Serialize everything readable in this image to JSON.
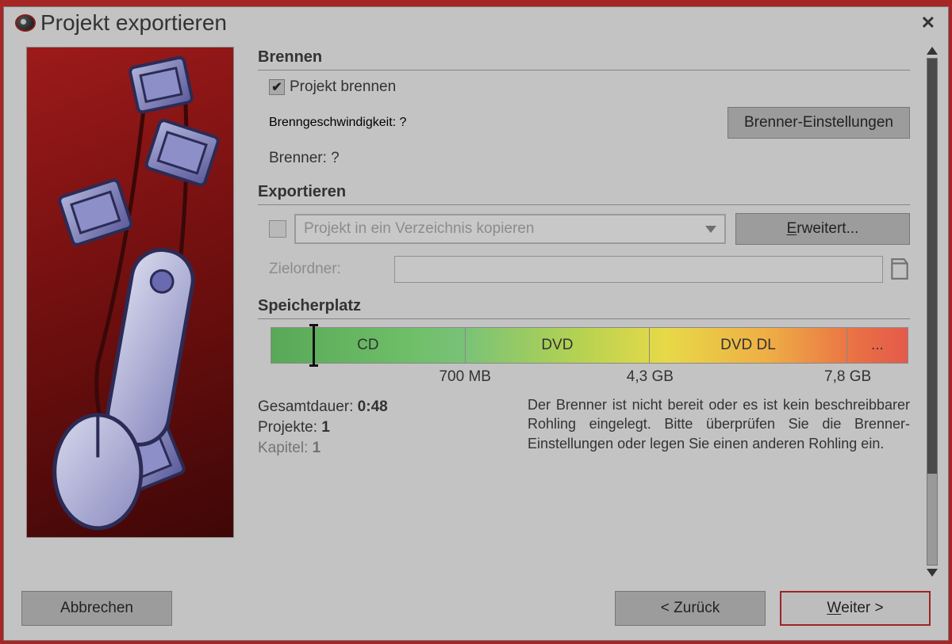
{
  "window": {
    "title": "Projekt exportieren"
  },
  "sections": {
    "burn": {
      "heading": "Brennen",
      "checkbox_label": "Projekt brennen",
      "speed_label": "Brenngeschwindigkeit: ?",
      "burner_label": "Brenner: ?",
      "settings_btn": "Brenner-Einstellungen"
    },
    "export": {
      "heading": "Exportieren",
      "dropdown_label": "Projekt in ein Verzeichnis kopieren",
      "advanced_btn_pre": "E",
      "advanced_btn_post": "rweitert...",
      "target_label": "Zielordner:"
    },
    "storage": {
      "heading": "Speicherplatz",
      "seg_cd": "CD",
      "seg_dvd": "DVD",
      "seg_dvddl": "DVD DL",
      "seg_more": "...",
      "mark_700": "700 MB",
      "mark_43": "4,3 GB",
      "mark_78": "7,8 GB",
      "total_label": "Gesamtdauer: ",
      "total_value": "0:48",
      "projects_label": "Projekte: ",
      "projects_value": "1",
      "chapters_label": "Kapitel: ",
      "chapters_value": "1",
      "warning": "Der Brenner ist nicht bereit oder es ist kein beschreibbarer Rohling eingelegt. Bitte überprüfen Sie die Brenner-Einstellungen oder legen Sie einen anderen Rohling ein."
    }
  },
  "footer": {
    "cancel": "Abbrechen",
    "back": "< Zurück",
    "next_pre": "W",
    "next_post": "eiter >"
  }
}
